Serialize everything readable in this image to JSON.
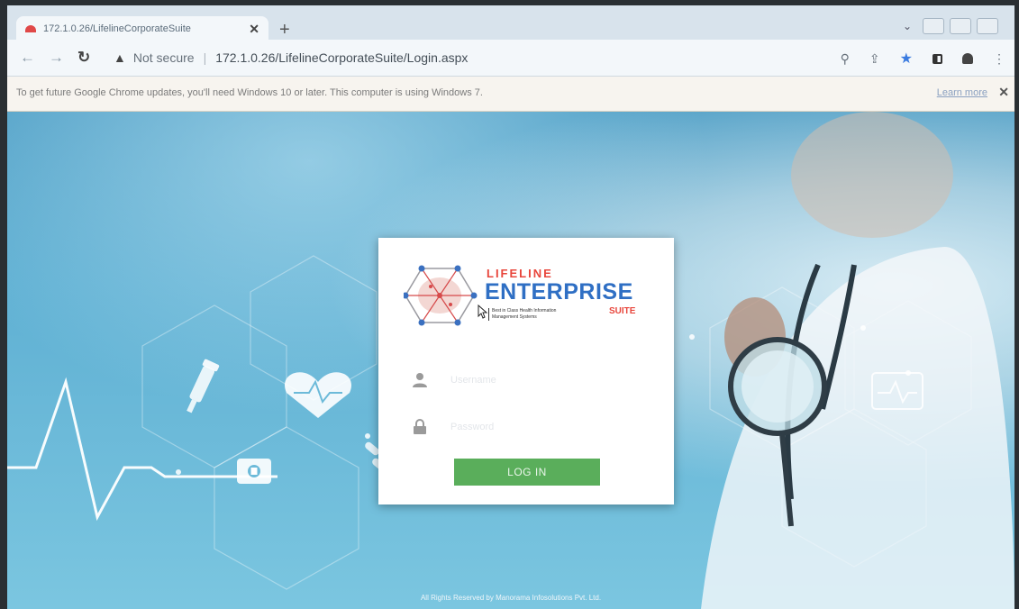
{
  "browser": {
    "tab_title": "172.1.0.26/LifelineCorporateSuite",
    "tab_close": "✕",
    "new_tab": "+",
    "not_secure": "Not secure",
    "url": "172.1.0.26/LifelineCorporateSuite/Login.aspx",
    "infobar": {
      "message": "To get future Google Chrome updates, you'll need Windows 10 or later. This computer is using Windows 7.",
      "learn_more": "Learn more",
      "close": "✕"
    },
    "toolbar_icons": [
      "search-icon",
      "share-icon",
      "star-icon",
      "side-panel-icon",
      "profile-icon",
      "menu-icon"
    ]
  },
  "login": {
    "brand": {
      "top": "LIFELINE",
      "main": "ENTERPRISE",
      "suite": "SUITE",
      "tagline_1": "Best in Class Health Information",
      "tagline_2": "Management Systems"
    },
    "username_placeholder": "Username",
    "password_placeholder": "Password",
    "button_label": "LOG IN"
  },
  "footer": {
    "text": "All Rights Reserved by Manorama Infosolutions Pvt. Ltd."
  },
  "colors": {
    "brand_blue": "#2f6fc4",
    "brand_red": "#e8463c",
    "login_green": "#5aae5b",
    "background_blue": "#5fb0d3"
  }
}
